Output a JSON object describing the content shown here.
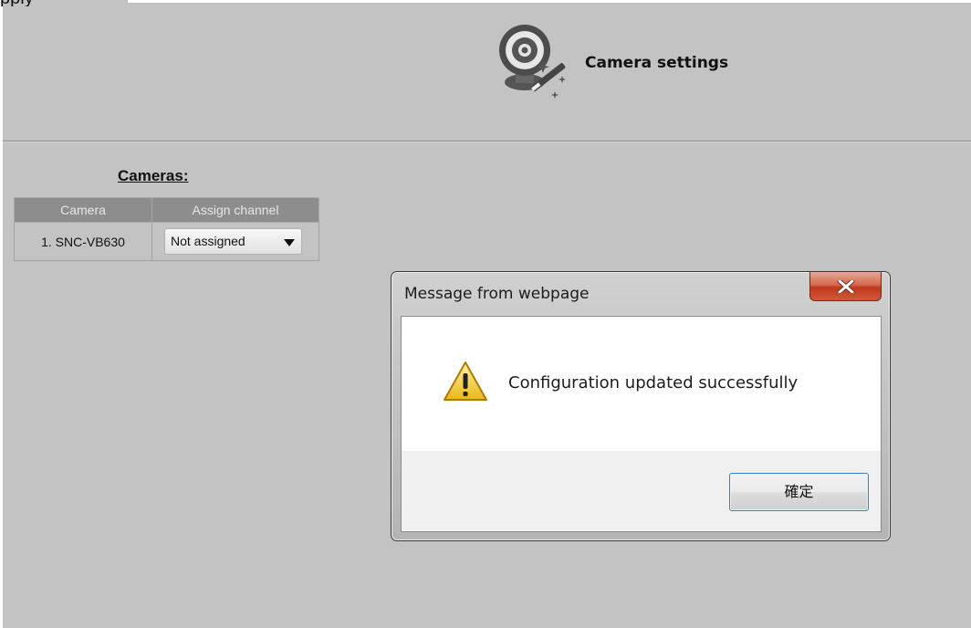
{
  "page": {
    "top_fragment": "pply",
    "header_title": "Camera settings",
    "header_icon": "camera-settings-icon"
  },
  "cameras": {
    "heading": "Cameras:",
    "columns": [
      "Camera",
      "Assign channel"
    ],
    "rows": [
      {
        "camera": "1. SNC-VB630",
        "channel": "Not assigned"
      }
    ]
  },
  "dialog": {
    "title": "Message from webpage",
    "close_label": "X",
    "message": "Configuration updated successfully",
    "ok_label": "確定",
    "icon": "warning-icon"
  },
  "colors": {
    "background": "#c3c3c3",
    "table_header": "#8d8d8d",
    "close_button": "#c7432a",
    "ok_button_border": "#3c7fb1"
  }
}
